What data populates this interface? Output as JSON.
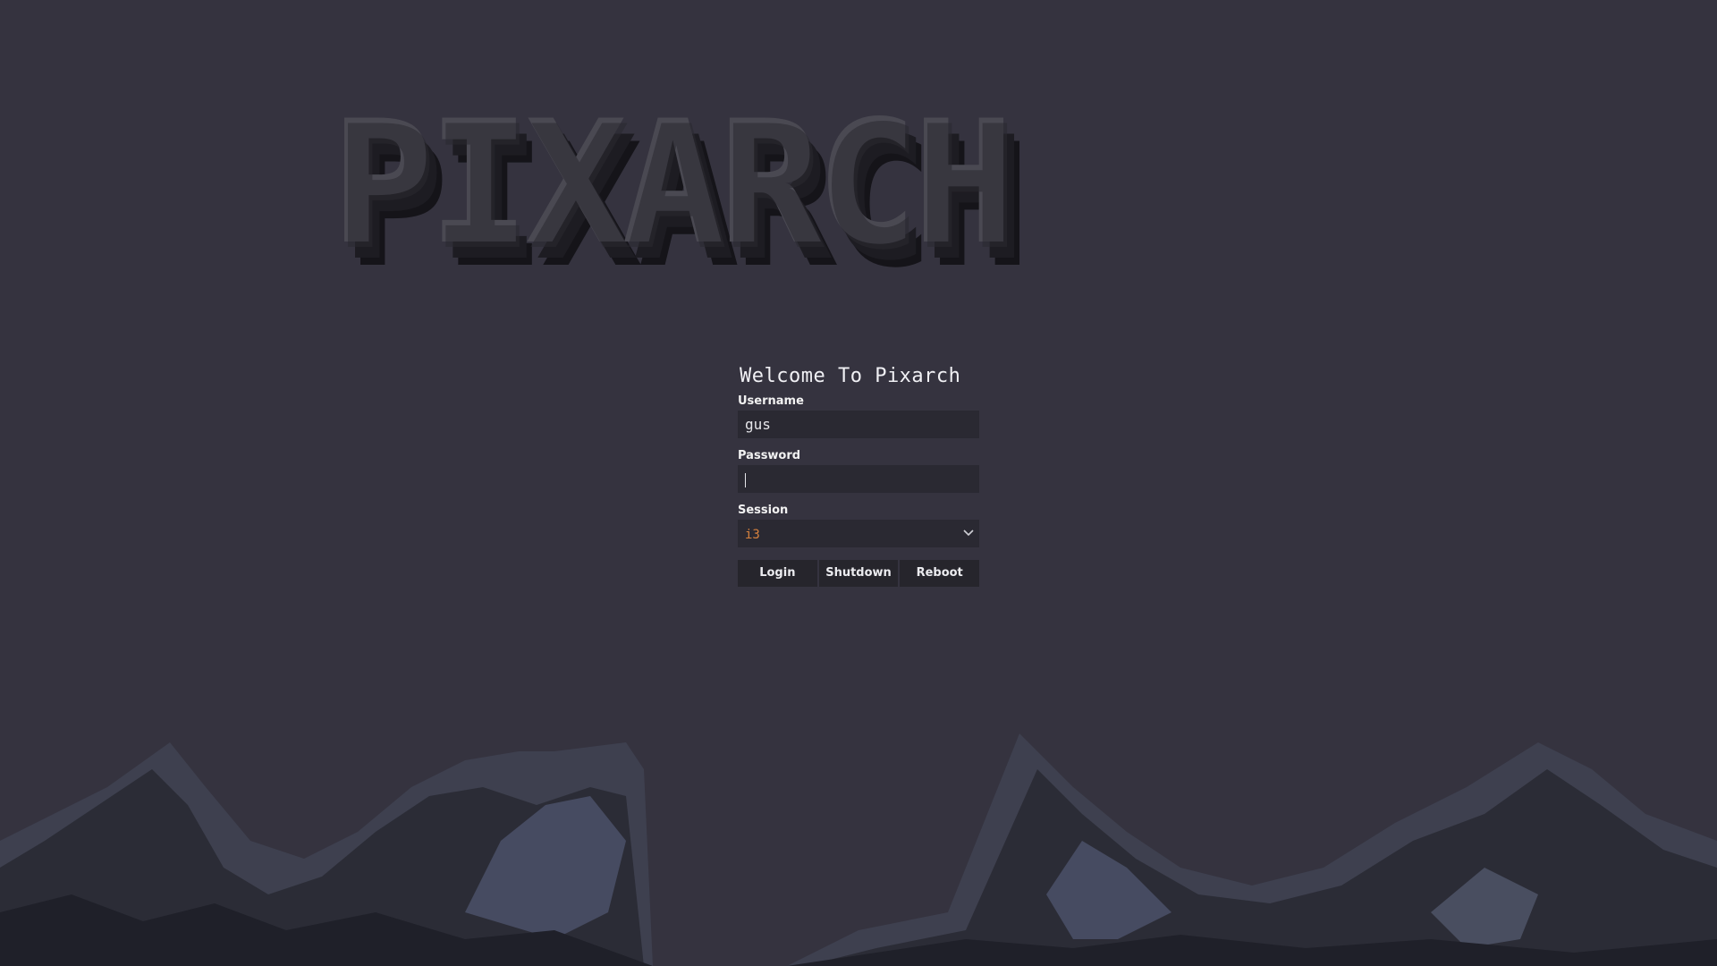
{
  "logo": {
    "text": "PIXARCH"
  },
  "greeter": {
    "title": "Welcome To Pixarch",
    "username": {
      "label": "Username",
      "value": "gus"
    },
    "password": {
      "label": "Password",
      "value": ""
    },
    "session": {
      "label": "Session",
      "selected": "i3"
    }
  },
  "buttons": {
    "login": "Login",
    "shutdown": "Shutdown",
    "reboot": "Reboot"
  },
  "colors": {
    "background": "#35333f",
    "input_bg": "#2a2932",
    "button_bg": "#26252c",
    "session_accent": "#d7823e"
  }
}
